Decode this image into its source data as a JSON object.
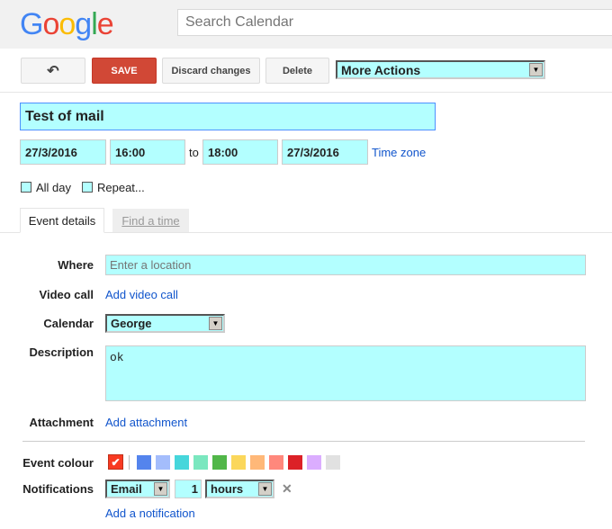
{
  "header": {
    "logo": "Google",
    "search_placeholder": "Search Calendar"
  },
  "toolbar": {
    "back_icon": "back-arrow-icon",
    "save": "SAVE",
    "discard": "Discard changes",
    "delete": "Delete",
    "more_actions": "More Actions"
  },
  "event": {
    "title": "Test of mail",
    "start_date": "27/3/2016",
    "start_time": "16:00",
    "to": "to",
    "end_time": "18:00",
    "end_date": "27/3/2016",
    "time_zone": "Time zone",
    "all_day": "All day",
    "repeat": "Repeat..."
  },
  "tabs": [
    {
      "label": "Event details",
      "active": true
    },
    {
      "label": "Find a time",
      "active": false
    }
  ],
  "details": {
    "where_label": "Where",
    "where_placeholder": "Enter a location",
    "video_label": "Video call",
    "video_link": "Add video call",
    "calendar_label": "Calendar",
    "calendar_value": "George",
    "description_label": "Description",
    "description_value": "ok",
    "attachment_label": "Attachment",
    "attachment_link": "Add attachment",
    "colour_label": "Event colour",
    "colours": {
      "selected": "#f83a22",
      "options": [
        "#5484ed",
        "#a4bdfc",
        "#46d6db",
        "#7ae7bf",
        "#51b749",
        "#fbd75b",
        "#ffb878",
        "#ff887c",
        "#dc2127",
        "#dbadff",
        "#e1e1e1"
      ]
    },
    "notifications_label": "Notifications",
    "notif_method": "Email",
    "notif_amount": "1",
    "notif_unit": "hours",
    "remove_icon": "close-icon",
    "add_notification": "Add a notification"
  },
  "colors": {
    "save": "#d14836",
    "link": "#1155cc",
    "input_bg": "#b3ffff"
  }
}
